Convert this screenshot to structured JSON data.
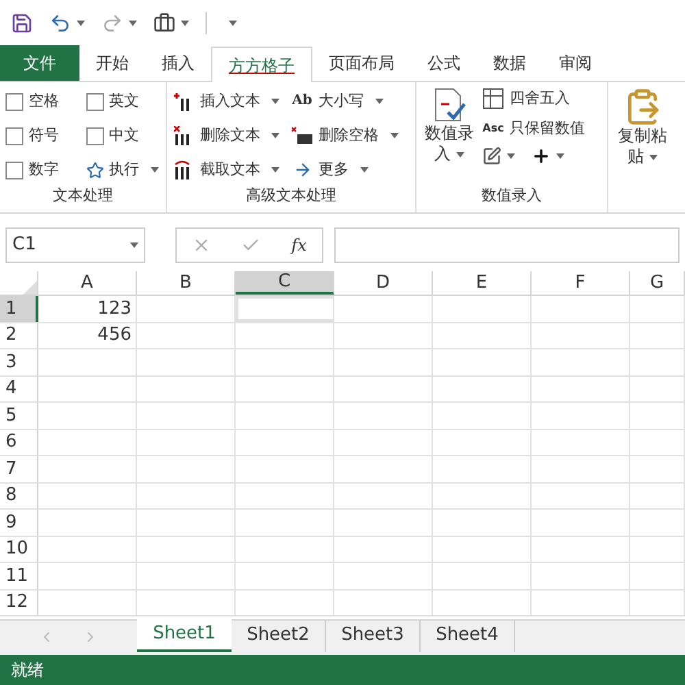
{
  "ribbon_tabs": [
    {
      "label": "文件",
      "kind": "file",
      "selected": false
    },
    {
      "label": "开始",
      "kind": "tab",
      "selected": false
    },
    {
      "label": "插入",
      "kind": "tab",
      "selected": false
    },
    {
      "label": "方方格子",
      "kind": "tab",
      "selected": true
    },
    {
      "label": "页面布局",
      "kind": "tab",
      "selected": false
    },
    {
      "label": "公式",
      "kind": "tab",
      "selected": false
    },
    {
      "label": "数据",
      "kind": "tab",
      "selected": false
    },
    {
      "label": "审阅",
      "kind": "tab",
      "selected": false
    }
  ],
  "text_group": {
    "title": "文本处理",
    "checkboxes": [
      {
        "label": "空格",
        "checked": false
      },
      {
        "label": "英文",
        "checked": false
      },
      {
        "label": "符号",
        "checked": false
      },
      {
        "label": "中文",
        "checked": false
      },
      {
        "label": "数字",
        "checked": false
      }
    ],
    "run_button": "执行"
  },
  "advanced_group": {
    "title": "高级文本处理",
    "buttons": [
      {
        "label": "插入文本"
      },
      {
        "label": "大小写",
        "icon_text": "Ab"
      },
      {
        "label": "删除文本"
      },
      {
        "label": "删除空格"
      },
      {
        "label": "截取文本"
      },
      {
        "label": "更多"
      }
    ]
  },
  "number_group": {
    "title": "数值录入",
    "big_button": "数值录入",
    "buttons": [
      {
        "label": "四舍五入"
      },
      {
        "label": "只保留数值",
        "icon_text": "Asc"
      }
    ]
  },
  "paste_button": "复制粘贴",
  "name_box": "C1",
  "function_button": "fx",
  "columns": [
    {
      "label": "A",
      "selected": false
    },
    {
      "label": "B",
      "selected": false
    },
    {
      "label": "C",
      "selected": true
    },
    {
      "label": "D",
      "selected": false
    },
    {
      "label": "E",
      "selected": false
    },
    {
      "label": "F",
      "selected": false
    },
    {
      "label": "G",
      "selected": false
    }
  ],
  "rows": [
    {
      "label": "1",
      "selected": true,
      "values": [
        "123"
      ]
    },
    {
      "label": "2",
      "selected": false,
      "values": [
        "456"
      ]
    },
    {
      "label": "3",
      "selected": false
    },
    {
      "label": "4",
      "selected": false
    },
    {
      "label": "5",
      "selected": false
    },
    {
      "label": "6",
      "selected": false
    },
    {
      "label": "7",
      "selected": false
    },
    {
      "label": "8",
      "selected": false
    },
    {
      "label": "9",
      "selected": false
    },
    {
      "label": "10",
      "selected": false
    },
    {
      "label": "11",
      "selected": false
    },
    {
      "label": "12",
      "selected": false
    }
  ],
  "sheet_tabs": [
    {
      "label": "Sheet1",
      "selected": true
    },
    {
      "label": "Sheet2",
      "selected": false
    },
    {
      "label": "Sheet3",
      "selected": false
    },
    {
      "label": "Sheet4",
      "selected": false
    }
  ],
  "status_bar": {
    "text": "就绪"
  }
}
